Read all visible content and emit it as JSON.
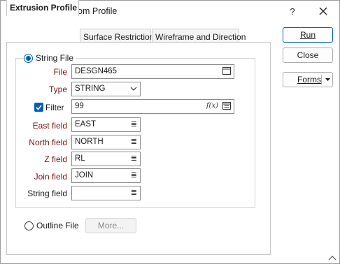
{
  "window": {
    "title": "Surface or Solid from Profile",
    "help_label": "?",
    "close_label": "✕"
  },
  "tabs": [
    {
      "label": "Extrusion Profile",
      "active": true
    },
    {
      "label": "Surface Restriction",
      "active": false
    },
    {
      "label": "Wireframe and Direction",
      "active": false
    }
  ],
  "string_file": {
    "label": "String File",
    "selected": true,
    "file": {
      "label": "File",
      "value": "DESGN465",
      "icon": "browse-file-icon"
    },
    "type": {
      "label": "Type",
      "value": "STRING",
      "icon": "chevron-down-icon"
    },
    "filter": {
      "label": "Filter",
      "checked": true,
      "value": "99",
      "fx_label": "f(x)",
      "icon": "filter-list-icon"
    },
    "east": {
      "label": "East field",
      "value": "EAST"
    },
    "north": {
      "label": "North field",
      "value": "NORTH"
    },
    "z": {
      "label": "Z field",
      "value": "RL"
    },
    "join": {
      "label": "Join field",
      "value": "JOIN"
    },
    "string": {
      "label": "String field",
      "value": ""
    }
  },
  "outline_file": {
    "label": "Outline File",
    "selected": false,
    "more_label": "More..."
  },
  "buttons": {
    "run": "Run",
    "close": "Close",
    "forms": "Forms"
  },
  "colors": {
    "accent": "#005fb8",
    "field_label": "#7a1414"
  }
}
